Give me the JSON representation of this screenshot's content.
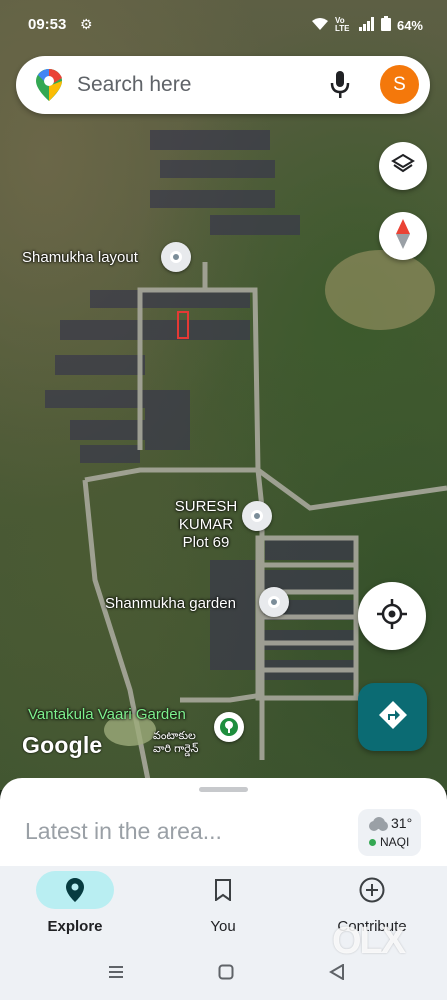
{
  "status": {
    "time": "09:53",
    "battery": "64%",
    "network": "Vo LTE"
  },
  "search": {
    "placeholder": "Search here",
    "avatar_initial": "S"
  },
  "map": {
    "places": [
      {
        "name": "Shamukha layout"
      },
      {
        "name": "SURESH KUMAR Plot 69"
      },
      {
        "name": "Shanmukha garden"
      },
      {
        "name": "Vantakula Vaari Garden"
      }
    ],
    "telugu_label": "వంటాకుల వారి గార్డెన్",
    "attribution": "Google"
  },
  "sheet": {
    "title": "Latest in the area...",
    "weather": {
      "temp": "31°",
      "aqi": "NAQI"
    }
  },
  "nav": {
    "items": [
      {
        "label": "Explore",
        "icon": "explore-pin-icon",
        "active": true
      },
      {
        "label": "You",
        "icon": "bookmark-icon",
        "active": false
      },
      {
        "label": "Contribute",
        "icon": "add-circle-icon",
        "active": false
      }
    ]
  },
  "watermark": "OLX",
  "colors": {
    "accent": "#0b6b73",
    "avatar": "#f4780b",
    "active_pill": "#b9eef2"
  }
}
